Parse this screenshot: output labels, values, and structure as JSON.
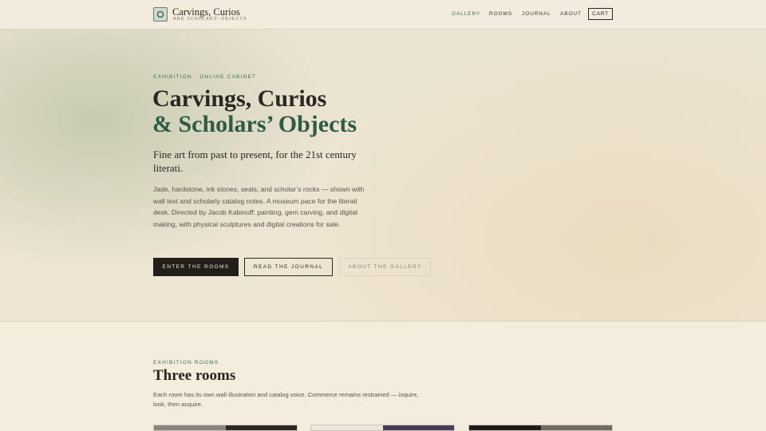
{
  "header": {
    "brand_title": "Carvings, Curios",
    "brand_subtitle": "AND SCHOLARS' OBJECTS",
    "nav": [
      {
        "label": "GALLERY",
        "active": true
      },
      {
        "label": "ROOMS",
        "active": false
      },
      {
        "label": "JOURNAL",
        "active": false
      },
      {
        "label": "ABOUT",
        "active": false
      }
    ],
    "cart_label": "CART"
  },
  "hero": {
    "eyebrow": "EXHIBITION · ONLINE CABINET",
    "title_line1": "Carvings, Curios",
    "title_line2": "& Scholars’ Objects",
    "tagline": "Fine art from past to present, for the 21st century literati.",
    "intro": "Jade, hardstone, ink stones, seals, and scholar’s rocks — shown with wall text and scholarly catalog notes. A museum pace for the literati desk. Directed by Jacob Kabinoff: painting, gem carving, and digital making, with physical sculptures and digital creations for sale.",
    "buttons": {
      "primary": "ENTER THE ROOMS",
      "secondary": "READ THE JOURNAL",
      "tertiary": "ABOUT THE GALLERY"
    }
  },
  "rooms": {
    "eyebrow": "EXHIBITION ROOMS",
    "title": "Three rooms",
    "description": "Each room has its own wall illustration and catalog voice. Commerce remains restrained — inquire, look, then acquire."
  },
  "colors": {
    "accent_green": "#3f6e50",
    "title_green": "#2f5a43",
    "ink": "#2a2621",
    "paper": "#f4ecdd"
  },
  "icons": {
    "logo": "ring-logo-icon"
  }
}
